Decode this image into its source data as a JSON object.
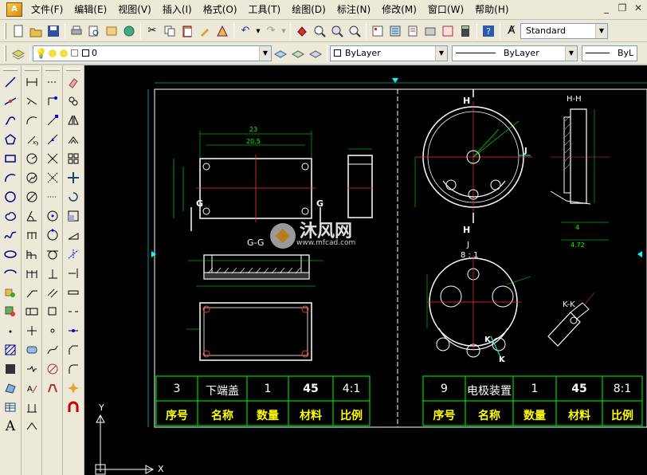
{
  "menubar": {
    "items": [
      "文件(F)",
      "编辑(E)",
      "视图(V)",
      "插入(I)",
      "格式(O)",
      "工具(T)",
      "绘图(D)",
      "标注(N)",
      "修改(M)",
      "窗口(W)",
      "帮助(H)"
    ]
  },
  "toolbar1": {
    "text_style": "Standard"
  },
  "toolbar2": {
    "layer_value": "0",
    "color_value": "ByLayer",
    "linetype_value": "ByLayer",
    "lineweight_value": "ByL"
  },
  "drawing": {
    "title_block_left": {
      "values": [
        "3",
        "下端盖",
        "1",
        "45",
        "4:1"
      ],
      "headers": [
        "序号",
        "名称",
        "数量",
        "材料",
        "比例"
      ]
    },
    "title_block_right": {
      "values": [
        "9",
        "电极装置",
        "1",
        "45",
        "8:1"
      ],
      "headers": [
        "序号",
        "名称",
        "数量",
        "材料",
        "比例"
      ]
    },
    "view_labels": {
      "section_gg": "G-G",
      "g_left": "G",
      "g_right": "G",
      "h_top": "H",
      "h_bottom": "H",
      "hh": "H-H",
      "j_arrow": "J",
      "j_view": "J",
      "scale_8_1": "8 : 1",
      "kk": "K-K",
      "k1": "K",
      "k2": "K"
    },
    "dimensions": {
      "w23": "23",
      "w20_5": "20.5",
      "w4": "4",
      "w4_72": "4.72"
    },
    "axis": {
      "y": "Y",
      "x": "X"
    },
    "watermark": {
      "brand": "沐风网",
      "url": "www.mfcad.com"
    }
  }
}
